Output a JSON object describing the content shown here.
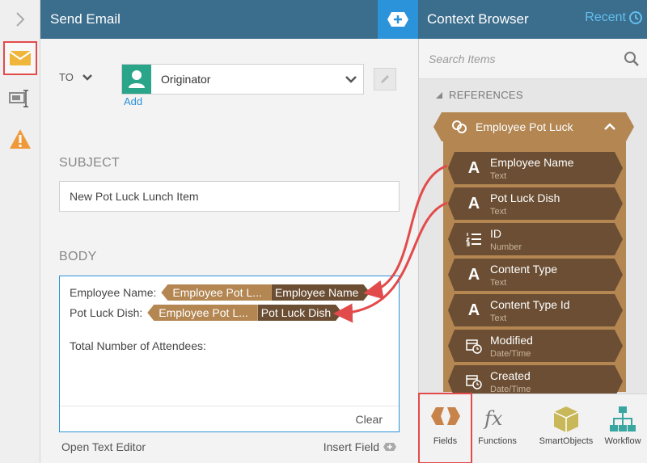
{
  "header": {
    "title": "Send Email",
    "context_title": "Context Browser",
    "recent_label": "Recent"
  },
  "form": {
    "to_label": "TO",
    "to_value": "Originator",
    "add_label": "Add",
    "subject_label": "SUBJECT",
    "subject_value": "New Pot Luck Lunch Item",
    "body_label": "BODY",
    "body_lines": [
      {
        "label": "Employee Name:",
        "token_source": "Employee Pot L...",
        "token_field": "Employee Name"
      },
      {
        "label": "Pot Luck Dish:",
        "token_source": "Employee Pot L...",
        "token_field": "Pot Luck Dish"
      }
    ],
    "body_text": "Total Number of Attendees:",
    "clear_label": "Clear",
    "open_editor_label": "Open Text Editor",
    "insert_field_label": "Insert Field"
  },
  "context": {
    "search_placeholder": "Search Items",
    "references_label": "REFERENCES",
    "group_name": "Employee Pot Luck",
    "fields": [
      {
        "name": "Employee Name",
        "type": "Text",
        "icon": "text-icon"
      },
      {
        "name": "Pot Luck Dish",
        "type": "Text",
        "icon": "text-icon"
      },
      {
        "name": "ID",
        "type": "Number",
        "icon": "number-icon"
      },
      {
        "name": "Content Type",
        "type": "Text",
        "icon": "text-icon"
      },
      {
        "name": "Content Type Id",
        "type": "Text",
        "icon": "text-icon"
      },
      {
        "name": "Modified",
        "type": "Date/Time",
        "icon": "datetime-icon"
      },
      {
        "name": "Created",
        "type": "Date/Time",
        "icon": "datetime-icon"
      }
    ]
  },
  "tabs": [
    {
      "label": "Fields",
      "icon": "fields-icon",
      "active": true
    },
    {
      "label": "Functions",
      "icon": "functions-icon",
      "active": false
    },
    {
      "label": "SmartObjects",
      "icon": "smartobjects-icon",
      "active": false
    },
    {
      "label": "Workflow",
      "icon": "workflow-icon",
      "active": false
    }
  ],
  "colors": {
    "header_bg": "#3b6d8c",
    "accent_blue": "#2a93d9",
    "token_light": "#b38652",
    "token_dark": "#6b4e33",
    "highlight_red": "#e24b4b",
    "avatar_green": "#2aa58a"
  }
}
